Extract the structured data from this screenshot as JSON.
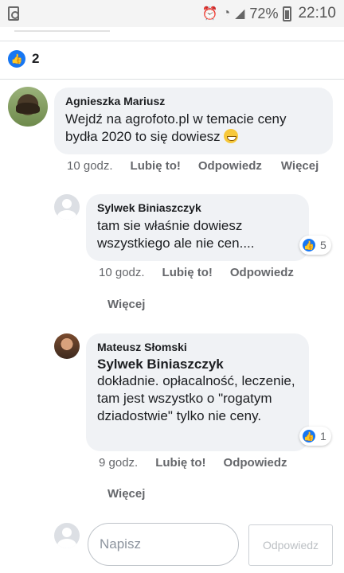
{
  "status_bar": {
    "battery": "72%",
    "time": "22:10"
  },
  "post": {
    "like_count": "2"
  },
  "comments": [
    {
      "author": "Agnieszka Mariusz",
      "text": "Wejdź na agrofoto.pl w temacie ceny bydła 2020 to się dowiesz",
      "timestamp": "10 godz.",
      "like_label": "Lubię to!",
      "reply_label": "Odpowiedz",
      "more_label": "Więcej"
    },
    {
      "author": "Sylwek Biniaszczyk",
      "text": "tam sie właśnie dowiesz wszystkiego ale nie cen....",
      "timestamp": "10 godz.",
      "like_label": "Lubię to!",
      "reply_label": "Odpowiedz",
      "more_label": "Więcej",
      "reaction_count": "5"
    },
    {
      "author": "Mateusz Słomski",
      "mention": "Sylwek Biniaszczyk",
      "text": "dokładnie. opłacalność, leczenie, tam jest wszystko o \"rogatym dziadostwie\" tylko nie ceny.",
      "timestamp": "9 godz.",
      "like_label": "Lubię to!",
      "reply_label": "Odpowiedz",
      "more_label": "Więcej",
      "reaction_count": "1"
    }
  ],
  "composer": {
    "placeholder": "Napisz",
    "send_label": "Odpowiedz"
  },
  "colors": {
    "accent": "#1877f2",
    "bubble": "#f0f2f5",
    "meta_text": "#65676b"
  },
  "icons": [
    "alarm-icon",
    "wifi-icon",
    "signal-icon",
    "battery-icon",
    "like-icon",
    "avatar-placeholder-icon"
  ]
}
